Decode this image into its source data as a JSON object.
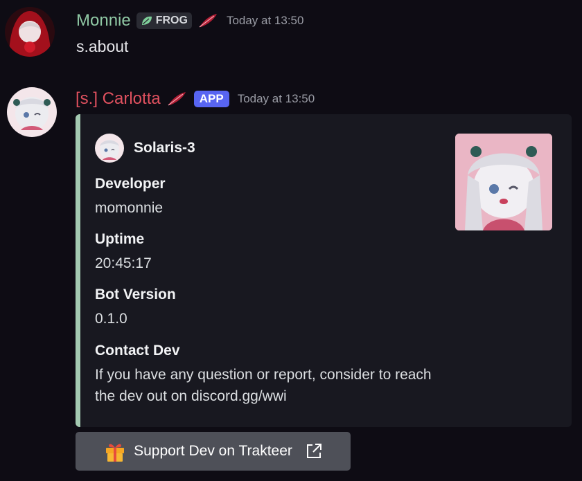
{
  "messages": [
    {
      "username": "Monnie",
      "username_color": "#8fc8a4",
      "tag_icon": "leaf-icon",
      "tag_label": "FROG",
      "timestamp": "Today at 13:50",
      "content": "s.about"
    },
    {
      "username": "[s.] Carlotta",
      "username_color": "#e0515f",
      "badge": "APP",
      "timestamp": "Today at 13:50"
    }
  ],
  "embed": {
    "accent_color": "#a3c9b1",
    "author_name": "Solaris-3",
    "fields": [
      {
        "name": "Developer",
        "value": "momonnie"
      },
      {
        "name": "Uptime",
        "value": "20:45:17"
      },
      {
        "name": "Bot Version",
        "value": "0.1.0"
      },
      {
        "name": "Contact Dev",
        "value": "If you have any question or report, consider to reach the dev out on discord.gg/wwi"
      }
    ]
  },
  "button": {
    "label": "Support Dev on Trakteer",
    "icon": "gift-icon",
    "trailing_icon": "external-link-icon"
  }
}
